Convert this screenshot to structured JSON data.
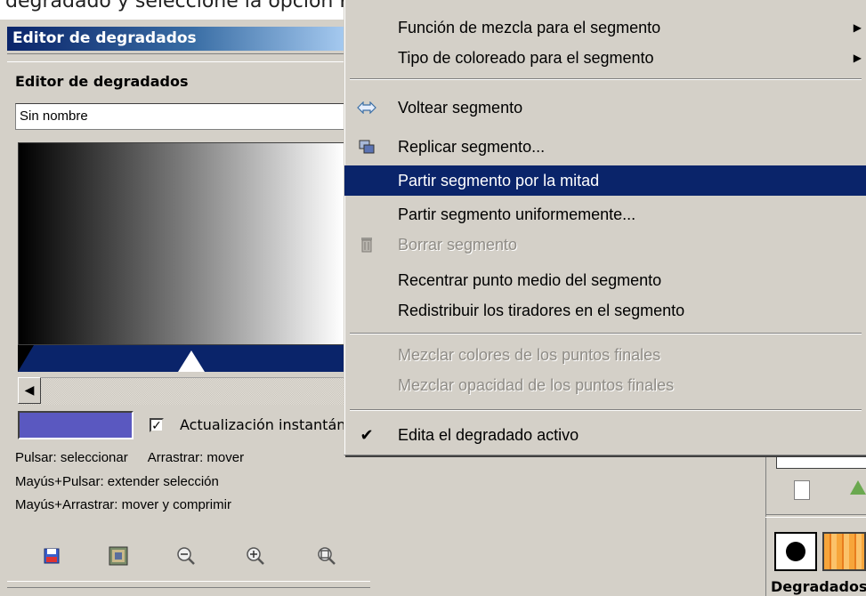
{
  "top_caption": "degradado y seleccione la opción Partir segmento por la mitad",
  "panel": {
    "title": "Editor de degradados",
    "editor_label": "Editor de degradados",
    "gradient_name": "Sin nombre",
    "instant_update_label": "Actualización instantánea",
    "instant_update_checked": true,
    "swatch_color": "#5a58c0",
    "hints": {
      "click": "Pulsar: seleccionar",
      "drag": "Arrastrar: mover",
      "shift_click": "Mayús+Pulsar: extender selección",
      "shift_drag": "Mayús+Arrastrar: mover y comprimir"
    },
    "toolbar_icons": [
      "save-icon",
      "gradient-pattern-icon",
      "zoom-out-icon",
      "zoom-in-icon",
      "zoom-all-icon"
    ]
  },
  "right_dock": {
    "bottom_text": "Degradados"
  },
  "context_menu": {
    "accent_color": "#0a246a",
    "items": {
      "blend_function": "Función de mezcla para el segmento",
      "coloring_type": "Tipo de coloreado para el segmento",
      "flip_segment": "Voltear segmento",
      "replicate_segment": "Replicar segmento...",
      "split_midpoint": "Partir segmento por la mitad",
      "split_uniform": "Partir segmento uniformemente...",
      "delete_segment": "Borrar segmento",
      "recenter_midpoint": "Recentrar punto medio del segmento",
      "redistribute_handles": "Redistribuir los tiradores en el segmento",
      "blend_endpoint_colors": "Mezclar colores de los puntos finales",
      "blend_endpoint_opacity": "Mezclar opacidad de los puntos finales",
      "edit_active_gradient": "Edita el degradado activo"
    },
    "highlighted": "split_midpoint",
    "disabled": [
      "delete_segment",
      "blend_endpoint_colors",
      "blend_endpoint_opacity"
    ]
  }
}
